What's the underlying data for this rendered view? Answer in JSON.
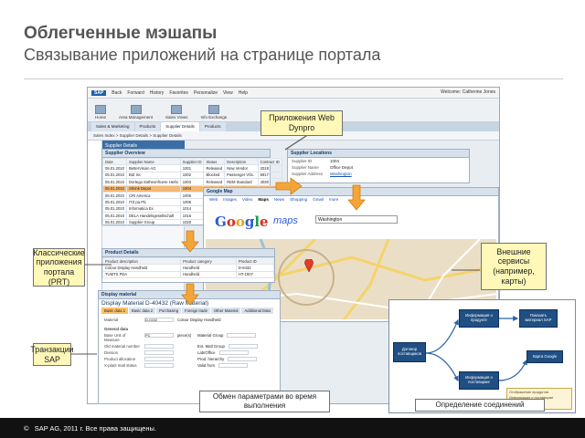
{
  "slide": {
    "title": "Облегченные мэшапы",
    "subtitle": "Связывание приложений на странице портала",
    "footer": "SAP AG, 2011 г. Все права защищены.",
    "footer_symbol": "©"
  },
  "callouts": {
    "web_dynpro": "Приложения Web Dynpro",
    "portal_apps": "Классические приложения портала (PRT)",
    "external": "Внешние сервисы (например, карты)",
    "sap_tx": "Транзакции SAP",
    "param_exchange": "Обмен параметрами во время выполнения",
    "connections": "Определение соединений"
  },
  "portal": {
    "logo": "SAP",
    "topbar": [
      "Back",
      "Forward",
      "History",
      "Favorites",
      "Personalize",
      "View",
      "Help"
    ],
    "user": "Welcome: Catherine Jones",
    "tools": [
      "Home",
      "Area Management",
      "Sales Views",
      "Info Exchange"
    ],
    "tabs": [
      "Sales & Marketing",
      "Products",
      "Supplier Details",
      "Products"
    ],
    "active_tab": 2,
    "subnav": "Sales Index  >  Supplier Details  >  Supplier Details",
    "left_nav": "Supplier Details",
    "full_screen": "Full Screen",
    "options": "Options"
  },
  "supplier_overview": {
    "title": "Supplier Overview",
    "headers": [
      "Date",
      "Supplier Name",
      "Supplier ID",
      "Status",
      "Description",
      "Contract ID"
    ],
    "rows": [
      [
        "05.01.2010",
        "BetterVision AG",
        "1001",
        "Released",
        "New Vendor",
        "2018"
      ],
      [
        "05.01.2010",
        "BIZ Inc",
        "1002",
        "Blocked",
        "Passenger VOL",
        "5917"
      ],
      [
        "05.01.2010",
        "Dortega Sotheonfruere Herbi",
        "1003",
        "Released",
        "REM Standard",
        "4030"
      ],
      [
        "05.01.2010",
        "Shrink Depot",
        "1004",
        "Released",
        "New Vendor",
        "4017"
      ],
      [
        "05.01.2010",
        "CRI America",
        "1005",
        "Released",
        "Standard Vendor",
        "1030"
      ],
      [
        "05.01.2010",
        "ITZ pa Plc",
        "1006",
        "Blocked",
        "New Laptop",
        "2029"
      ],
      [
        "05.01.2010",
        "Informatica Ex",
        "1014",
        "Released",
        "Keyboard",
        "2214"
      ],
      [
        "05.01.2010",
        "DELA Handelsgesellschaft",
        "1016",
        "Released",
        "Mouse",
        "1878"
      ],
      [
        "05.01.2010",
        "Supplier Group",
        "1020",
        "Released",
        "New Vendor",
        "5030"
      ]
    ],
    "selected_row": 3
  },
  "supplier_locations": {
    "title": "Supplier Locations",
    "fields": [
      [
        "Supplier ID",
        "1004"
      ],
      [
        "Supplier Name",
        "Office Depot"
      ],
      [
        "Supplier Address",
        "Washington"
      ]
    ]
  },
  "google_map": {
    "title": "Google Map",
    "links": [
      "Web",
      "Images",
      "Video",
      "Maps",
      "News",
      "Shopping",
      "Gmail",
      "more"
    ],
    "search_value": "Washington",
    "map_types": [
      "Traffic",
      "More",
      "Map",
      "Satellite",
      "Terrain"
    ],
    "copyright": "©2010 Google - Map data"
  },
  "product_details": {
    "title": "Product Details",
    "headers": [
      "Product description",
      "Product category",
      "Product ID"
    ],
    "rows": [
      [
        "Colour Display Handheld",
        "Handheld",
        "D-8432"
      ],
      [
        "TUMTS PDA",
        "Handheld",
        "HT-1007"
      ]
    ]
  },
  "display_material": {
    "panel_title": "Display material",
    "heading": "Display Material D-40432 (Raw Material)",
    "tabs": [
      "Basic data 1",
      "Basic data 2",
      "Purchasing",
      "Foreign trade",
      "Other Material",
      "Additional Data",
      "Org. Levels",
      "Check"
    ],
    "material_label": "Material",
    "material_value": "D-0432",
    "material_desc": "Colour Display Handheld",
    "section": "General data",
    "fields": [
      "Base Unit of Measure",
      "Old material number",
      "Division",
      "Product allocation",
      "X-plant matl status"
    ],
    "right_fields": [
      "Material Group",
      "Ext. Matl Group",
      "Lab/Office",
      "Prod. hierarchy",
      "Valid from"
    ],
    "unit_value": "PC",
    "unit_name": "piece(s)"
  },
  "diagram": {
    "nodes": {
      "supplier_list": "Договор поставщиков",
      "product_info": "Информация о продукте",
      "material_info": "Показать материал SAP",
      "supplier_info": "Информация о поставщике",
      "google_map": "Карта Google"
    },
    "legend": [
      "Отображение продуктов",
      "Информация о поставщике"
    ]
  }
}
